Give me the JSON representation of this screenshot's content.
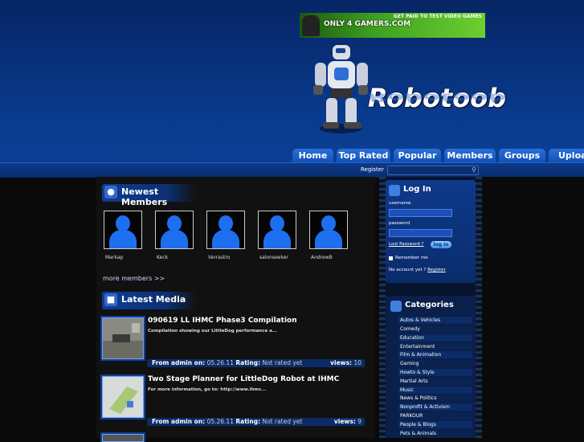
{
  "banner": {
    "logo_text": "ONLY 4 GAMERS.COM",
    "tagline": "GET PAID TO TEST VIDEO GAMES"
  },
  "brand": {
    "name": "Robotoob"
  },
  "nav": {
    "tabs": [
      "Home",
      "Top Rated",
      "Popular",
      "Members",
      "Groups",
      "Upload"
    ]
  },
  "subbar": {
    "register_label": "Register",
    "search_placeholder": ""
  },
  "newest_members": {
    "title": "Newest Members",
    "members": [
      "Markap",
      "Keck",
      "Verrastro",
      "salonseeker",
      "AndrewB"
    ],
    "more_link": "more members >>"
  },
  "latest_media": {
    "title": "Latest Media",
    "items": [
      {
        "title": "090619 LL IHMC Phase3 Compilation",
        "desc": "Compilation showing our LittleDog performance a...",
        "from_label": "From admin on:",
        "date": "05.26.11",
        "rating_label": "Rating:",
        "rating": "Not rated yet",
        "views_label": "views:",
        "views": "10"
      },
      {
        "title": "Two Stage Planner for LittleDog Robot at IHMC",
        "desc": "For more information, go to: http://www.ihmc...",
        "from_label": "From admin on:",
        "date": "05.26.11",
        "rating_label": "Rating:",
        "rating": "Not rated yet",
        "views_label": "views:",
        "views": "9"
      }
    ]
  },
  "login": {
    "title": "Log In",
    "username_label": "username",
    "password_label": "password",
    "lost_password": "Lost Password ?",
    "login_button": "log in",
    "remember_me": "Remember me",
    "no_account": "No account yet ?",
    "register_link": "Register"
  },
  "categories": {
    "title": "Categories",
    "items": [
      "Autos & Vehicles",
      "Comedy",
      "Education",
      "Entertainment",
      "Film & Animation",
      "Gaming",
      "Howto & Style",
      "Martial Arts",
      "Music",
      "News & Politics",
      "Nonprofit & Activism",
      "PARKOUR",
      "People & Blogs",
      "Pets & Animals"
    ]
  },
  "colors": {
    "accent": "#1e6ff0",
    "nav_tab": "#1a5fd0",
    "header_bg": "#0a3a8c"
  }
}
